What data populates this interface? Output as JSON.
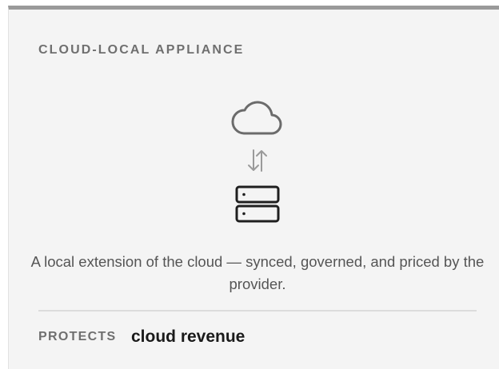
{
  "card": {
    "title": "CLOUD-LOCAL APPLIANCE",
    "description": "A local extension of the cloud — synced, governed, and priced by the provider.",
    "protects_label": "PROTECTS",
    "protects_value": "cloud revenue"
  },
  "icons": {
    "top": "cloud-icon",
    "middle": "sync-arrows-icon",
    "bottom": "server-icon"
  },
  "colors": {
    "top_border": "#9a9a9a",
    "card_background": "#f4f4f4",
    "cloud_icon": "#6b6b6b",
    "arrows_icon": "#9a9a9a",
    "server_icon": "#1f1f1f",
    "value_text": "#1a1a1a"
  }
}
